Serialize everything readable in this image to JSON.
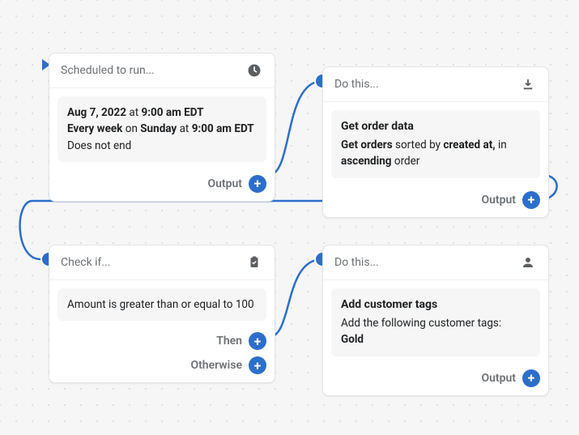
{
  "connectors": {
    "accent": "#2c6ecb"
  },
  "nodes": {
    "scheduled": {
      "header": "Scheduled to run...",
      "line1_date": "Aug 7, 2022",
      "line1_at": " at ",
      "line1_time": "9:00 am EDT",
      "line2_every": "Every week",
      "line2_on": " on ",
      "line2_day": "Sunday",
      "line2_at": " at ",
      "line2_time": "9:00 am EDT",
      "line3": "Does not end",
      "output_label": "Output"
    },
    "getorder": {
      "header": "Do this...",
      "title": "Get order data",
      "d_getorders": "Get orders",
      "d_sortedby": " sorted by ",
      "d_createdat": "created at,",
      "d_in": " in ",
      "d_ascending": "ascending",
      "d_order": " order",
      "output_label": "Output"
    },
    "checkif": {
      "header": "Check if...",
      "condition": "Amount is greater than or equal to 100",
      "then_label": "Then",
      "otherwise_label": "Otherwise"
    },
    "addtags": {
      "header": "Do this...",
      "title": "Add customer tags",
      "desc": "Add the following customer tags:",
      "tag": "Gold",
      "output_label": "Output"
    }
  }
}
